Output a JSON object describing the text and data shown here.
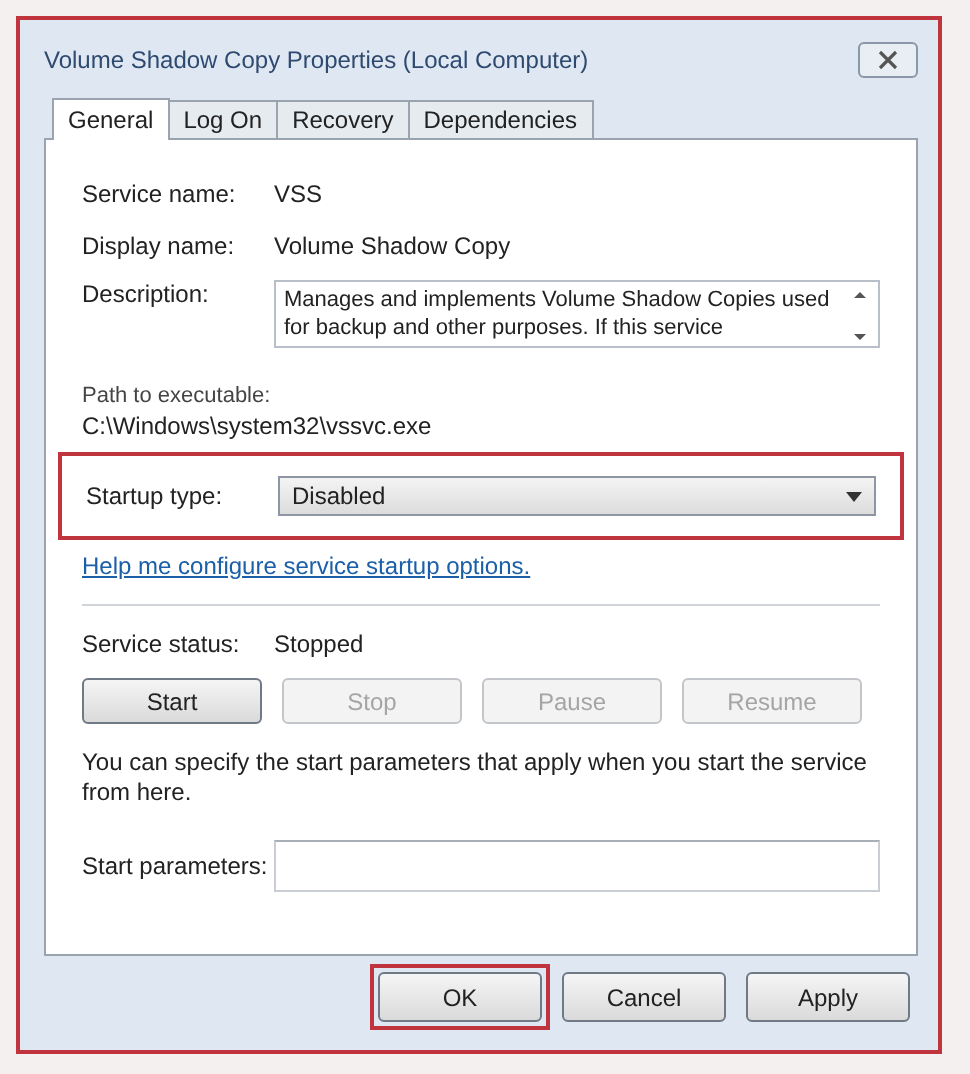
{
  "window": {
    "title": "Volume Shadow Copy Properties (Local Computer)",
    "highlighted": true
  },
  "tabs": [
    {
      "label": "General",
      "selected": true
    },
    {
      "label": "Log On",
      "selected": false
    },
    {
      "label": "Recovery",
      "selected": false
    },
    {
      "label": "Dependencies",
      "selected": false
    }
  ],
  "info": [
    {
      "label": "Service name:",
      "value": "VSS"
    },
    {
      "label": "Display name:",
      "value": "Volume Shadow Copy"
    }
  ],
  "description": {
    "label": "Description:",
    "text": "Manages and implements Volume Shadow Copies used for backup and other purposes. If this service"
  },
  "path": {
    "label": "Path to executable:",
    "value": "C:\\Windows\\system32\\vssvc.exe"
  },
  "startup_type": {
    "label": "Startup type:",
    "value": "Disabled",
    "highlighted": true
  },
  "help_link": "Help me configure service startup options.",
  "service_status": {
    "label": "Service status:",
    "value": "Stopped"
  },
  "control_buttons": [
    {
      "label": "Start",
      "disabled": false
    },
    {
      "label": "Stop",
      "disabled": true
    },
    {
      "label": "Pause",
      "disabled": true
    },
    {
      "label": "Resume",
      "disabled": true
    }
  ],
  "start_hint": "You can specify the start parameters that apply when you start the service from here.",
  "start_parameters": {
    "label": "Start parameters:"
  },
  "dialog_buttons": [
    {
      "label": "OK",
      "highlighted": true
    },
    {
      "label": "Cancel",
      "highlighted": false
    },
    {
      "label": "Apply",
      "highlighted": false
    }
  ]
}
